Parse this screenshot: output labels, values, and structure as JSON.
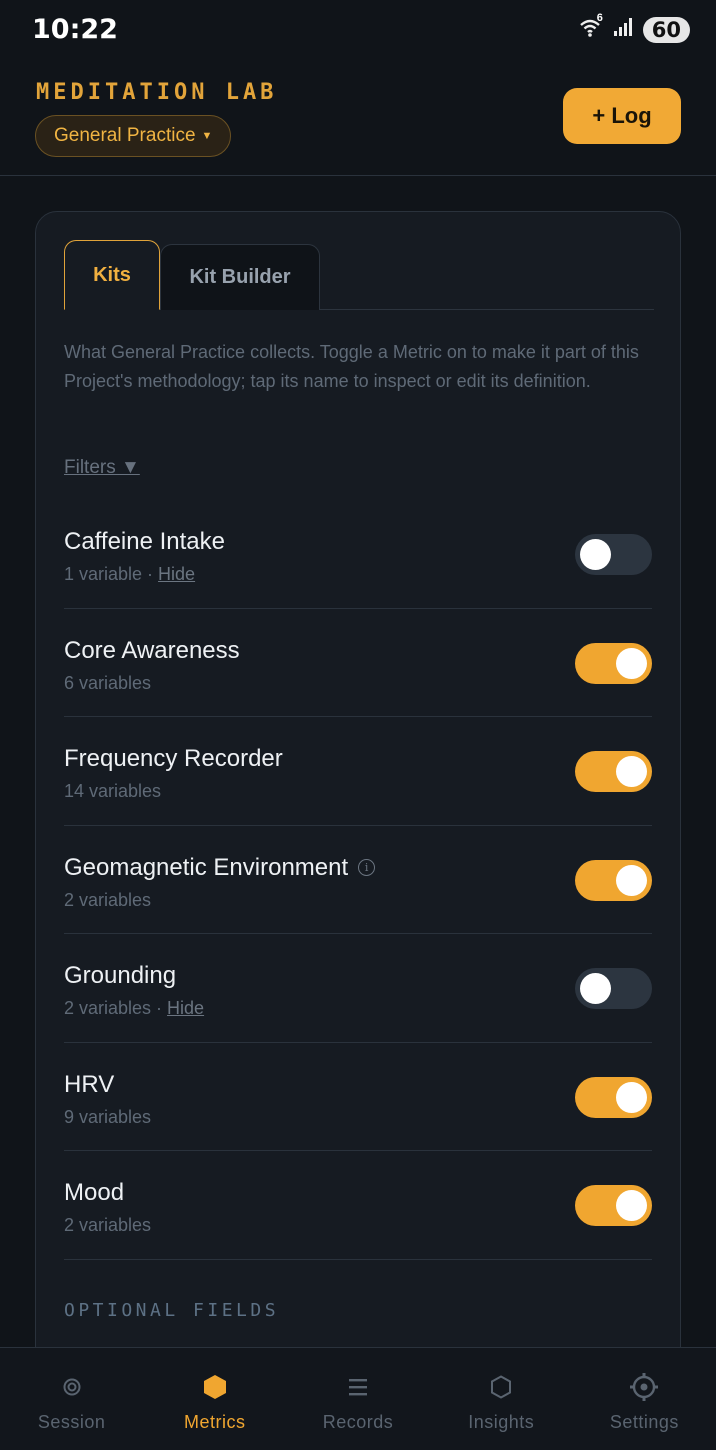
{
  "status_bar": {
    "time": "10:22",
    "battery": "60",
    "wifi_badge": "6"
  },
  "header": {
    "brand": "MEDITATION LAB",
    "project": "General Practice",
    "log_button": "+ Log"
  },
  "tabs": [
    {
      "label": "Kits",
      "active": true
    },
    {
      "label": "Kit Builder",
      "active": false
    }
  ],
  "description": "What General Practice collects. Toggle a Metric on to make it part of this Project's methodology; tap its name to inspect or edit its definition.",
  "filters_label": "Filters ▼",
  "metrics": [
    {
      "name": "Caffeine Intake",
      "count": "1 variable",
      "hide": "Hide",
      "enabled": false
    },
    {
      "name": "Core Awareness",
      "count": "6 variables",
      "hide": "",
      "enabled": true
    },
    {
      "name": "Frequency Recorder",
      "count": "14 variables",
      "hide": "",
      "enabled": true
    },
    {
      "name": "Geomagnetic Environment",
      "count": "2 variables",
      "hide": "",
      "enabled": true,
      "info": true
    },
    {
      "name": "Grounding",
      "count": "2 variables",
      "hide": "Hide",
      "enabled": false
    },
    {
      "name": "HRV",
      "count": "9 variables",
      "hide": "",
      "enabled": true
    },
    {
      "name": "Mood",
      "count": "2 variables",
      "hide": "",
      "enabled": true
    }
  ],
  "optional_fields_heading": "OPTIONAL FIELDS",
  "nav": [
    {
      "label": "Session",
      "icon": "session-icon",
      "active": false
    },
    {
      "label": "Metrics",
      "icon": "metrics-icon",
      "active": true
    },
    {
      "label": "Records",
      "icon": "records-icon",
      "active": false
    },
    {
      "label": "Insights",
      "icon": "insights-icon",
      "active": false
    },
    {
      "label": "Settings",
      "icon": "settings-icon",
      "active": false
    }
  ],
  "colors": {
    "accent": "#f0a630",
    "background": "#101419",
    "card": "#161b22"
  }
}
